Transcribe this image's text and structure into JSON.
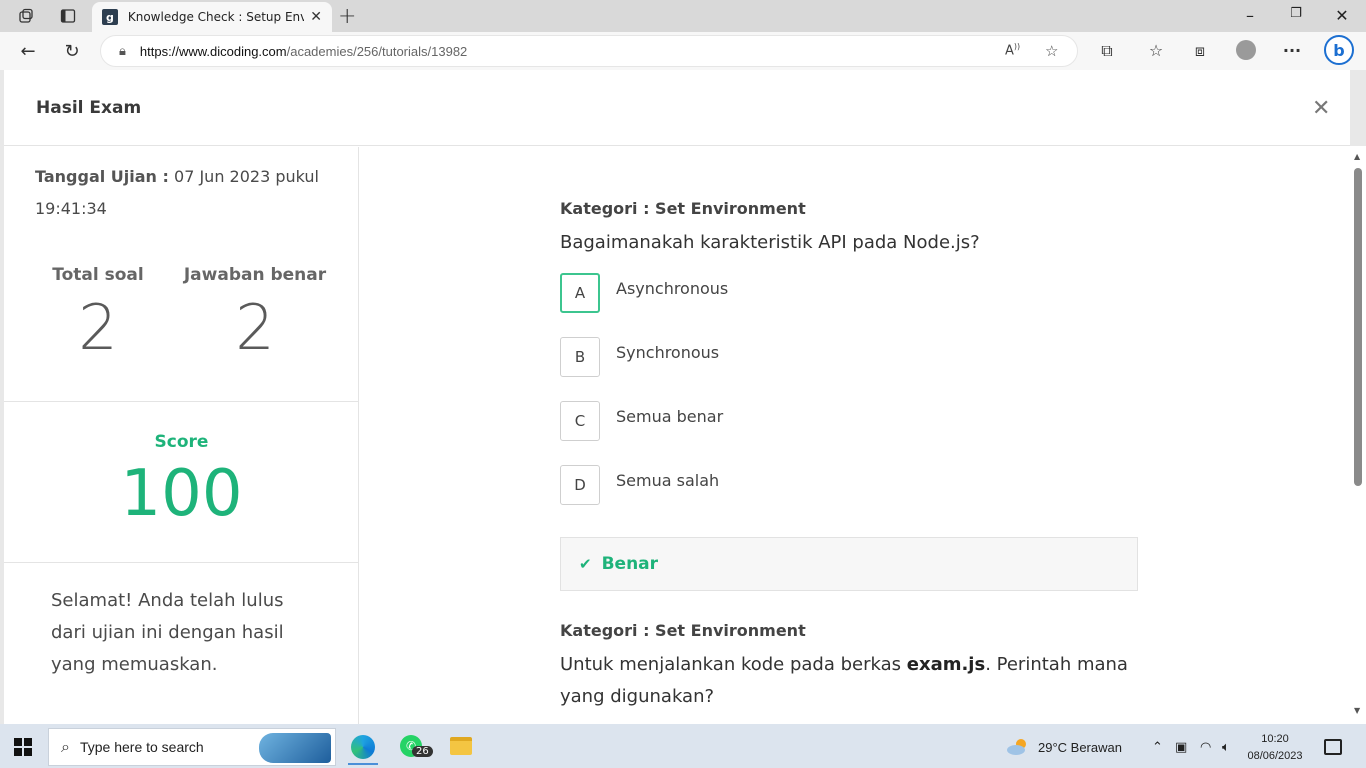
{
  "browser": {
    "tab_title": "Knowledge Check : Setup Environ",
    "favicon_letter": "g",
    "url_host": "https://www.dicoding.com",
    "url_path": "/academies/256/tutorials/13982"
  },
  "modal": {
    "title": "Hasil Exam",
    "close_glyph": "✕"
  },
  "summary": {
    "date_label": "Tanggal Ujian :",
    "date_value": " 07 Jun 2023 pukul 19:41:34",
    "total_label": "Total soal",
    "total_value": "2",
    "correct_label": "Jawaban benar",
    "correct_value": "2",
    "score_label": "Score",
    "score_value": "100",
    "message": "Selamat! Anda telah lulus dari ujian ini dengan hasil yang memuaskan."
  },
  "questions": [
    {
      "category": "Kategori : Set Environment",
      "text": "Bagaimanakah karakteristik API pada Node.js?",
      "options": [
        {
          "letter": "A",
          "text": "Asynchronous"
        },
        {
          "letter": "B",
          "text": "Synchronous"
        },
        {
          "letter": "C",
          "text": "Semua benar"
        },
        {
          "letter": "D",
          "text": "Semua salah"
        }
      ],
      "result": "Benar"
    },
    {
      "category": "Kategori : Set Environment",
      "text_before": "Untuk menjalankan kode pada berkas ",
      "text_bold": "exam.js",
      "text_after": ". Perintah mana yang digunakan?"
    }
  ],
  "taskbar": {
    "search_placeholder": "Type here to search",
    "whatsapp_badge": "26",
    "weather": "29°C  Berawan",
    "time": "10:20",
    "date": "08/06/2023"
  },
  "colors": {
    "accent_green": "#1eb37a",
    "correct_border": "#3cc58f"
  }
}
